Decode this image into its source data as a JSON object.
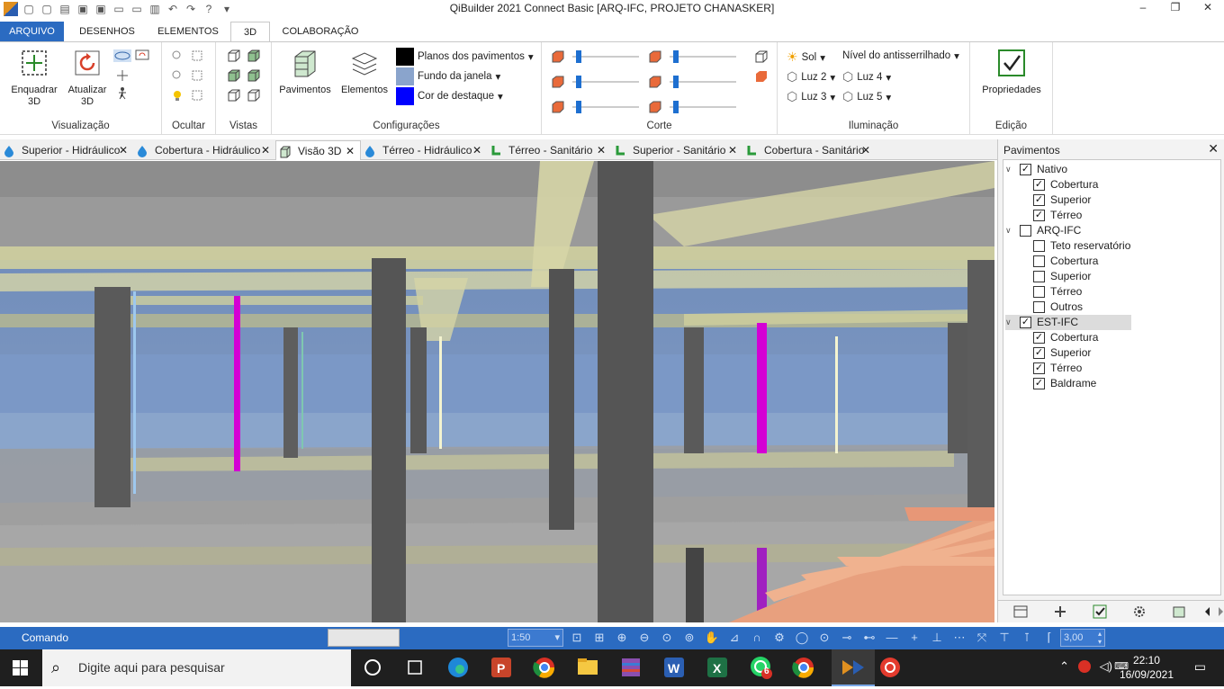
{
  "window": {
    "title": "QiBuilder 2021 Connect Basic [ARQ-IFC, PROJETO CHANASKER]",
    "controls": [
      "minimize",
      "restore",
      "close"
    ]
  },
  "ribbon_tabs": [
    "ARQUIVO",
    "DESENHOS",
    "ELEMENTOS",
    "3D",
    "COLABORAÇÃO"
  ],
  "active_tab": "3D",
  "ribbon": {
    "visualizacao": {
      "label": "Visualização",
      "enquadrar": "Enquadrar 3D",
      "enquadrar_l1": "Enquadrar",
      "enquadrar_l2": "3D",
      "atualizar_l1": "Atualizar",
      "atualizar_l2": "3D"
    },
    "ocultar": {
      "label": "Ocultar"
    },
    "vistas": {
      "label": "Vistas"
    },
    "configuracoes": {
      "label": "Configurações",
      "pavimentos": "Pavimentos",
      "elementos": "Elementos",
      "planos": "Planos dos pavimentos",
      "fundo": "Fundo da janela",
      "destaque": "Cor de destaque",
      "planos_color": "#000000",
      "fundo_color": "#8aa4cc",
      "destaque_color": "#0000ff"
    },
    "corte": {
      "label": "Corte"
    },
    "iluminacao": {
      "label": "Iluminação",
      "sol": "Sol",
      "antisserrilhado": "Nível do antisserrilhado",
      "luz2": "Luz 2",
      "luz3": "Luz 3",
      "luz4": "Luz 4",
      "luz5": "Luz 5"
    },
    "edicao": {
      "label": "Edição",
      "propriedades": "Propriedades"
    }
  },
  "doc_tabs": [
    {
      "label": "Superior - Hidráulico",
      "icon": "drop-icon",
      "active": false
    },
    {
      "label": "Cobertura - Hidráulico",
      "icon": "drop-icon",
      "active": false
    },
    {
      "label": "Visão 3D",
      "icon": "cube-icon",
      "active": true
    },
    {
      "label": "Térreo - Hidráulico",
      "icon": "drop-icon",
      "active": false
    },
    {
      "label": "Térreo - Sanitário",
      "icon": "pipe-icon",
      "active": false
    },
    {
      "label": "Superior - Sanitário",
      "icon": "pipe-icon",
      "active": false
    },
    {
      "label": "Cobertura - Sanitário",
      "icon": "pipe-icon",
      "active": false
    }
  ],
  "panel": {
    "title": "Pavimentos",
    "tree": [
      {
        "label": "Nativo",
        "level": 0,
        "checked": true,
        "expanded": true
      },
      {
        "label": "Cobertura",
        "level": 1,
        "checked": true
      },
      {
        "label": "Superior",
        "level": 1,
        "checked": true
      },
      {
        "label": "Térreo",
        "level": 1,
        "checked": true
      },
      {
        "label": "ARQ-IFC",
        "level": 0,
        "checked": false,
        "expanded": true
      },
      {
        "label": "Teto reservatório",
        "level": 1,
        "checked": false
      },
      {
        "label": "Cobertura",
        "level": 1,
        "checked": false
      },
      {
        "label": "Superior",
        "level": 1,
        "checked": false
      },
      {
        "label": "Térreo",
        "level": 1,
        "checked": false
      },
      {
        "label": "Outros",
        "level": 1,
        "checked": false
      },
      {
        "label": "EST-IFC",
        "level": 0,
        "checked": true,
        "expanded": true,
        "selected": true
      },
      {
        "label": "Cobertura",
        "level": 1,
        "checked": true
      },
      {
        "label": "Superior",
        "level": 1,
        "checked": true
      },
      {
        "label": "Térreo",
        "level": 1,
        "checked": true
      },
      {
        "label": "Baldrame",
        "level": 1,
        "checked": true
      }
    ]
  },
  "command_bar": {
    "label": "Comando",
    "scale": "1:50",
    "snap_value": "3,00"
  },
  "taskbar": {
    "search_placeholder": "Digite aqui para pesquisar",
    "time": "22:10",
    "date": "16/09/2021",
    "whatsapp_badge": "6"
  },
  "colors": {
    "accent": "#2b6bc1",
    "pipe_magenta": "#d400d4",
    "stairs": "#e8a07e",
    "beams": "#d9d8a8"
  }
}
